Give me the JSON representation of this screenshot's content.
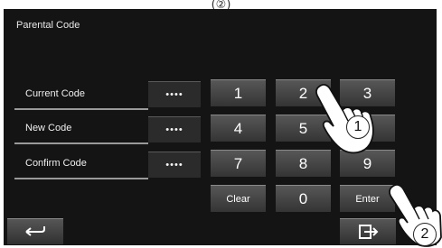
{
  "caption": "(②)",
  "title": "Parental Code",
  "rows": [
    {
      "label": "Current Code",
      "value": "••••"
    },
    {
      "label": "New Code",
      "value": "••••"
    },
    {
      "label": "Confirm Code",
      "value": "••••"
    }
  ],
  "keypad": {
    "k1": "1",
    "k2": "2",
    "k3": "3",
    "k4": "4",
    "k5": "5",
    "k6": "6",
    "k7": "7",
    "k8": "8",
    "k9": "9",
    "clear": "Clear",
    "k0": "0",
    "enter": "Enter"
  },
  "callouts": {
    "one": "1",
    "two": "2"
  },
  "icons": {
    "back": "back-arrow-icon",
    "exit": "exit-icon",
    "hand": "pointing-hand-icon"
  }
}
